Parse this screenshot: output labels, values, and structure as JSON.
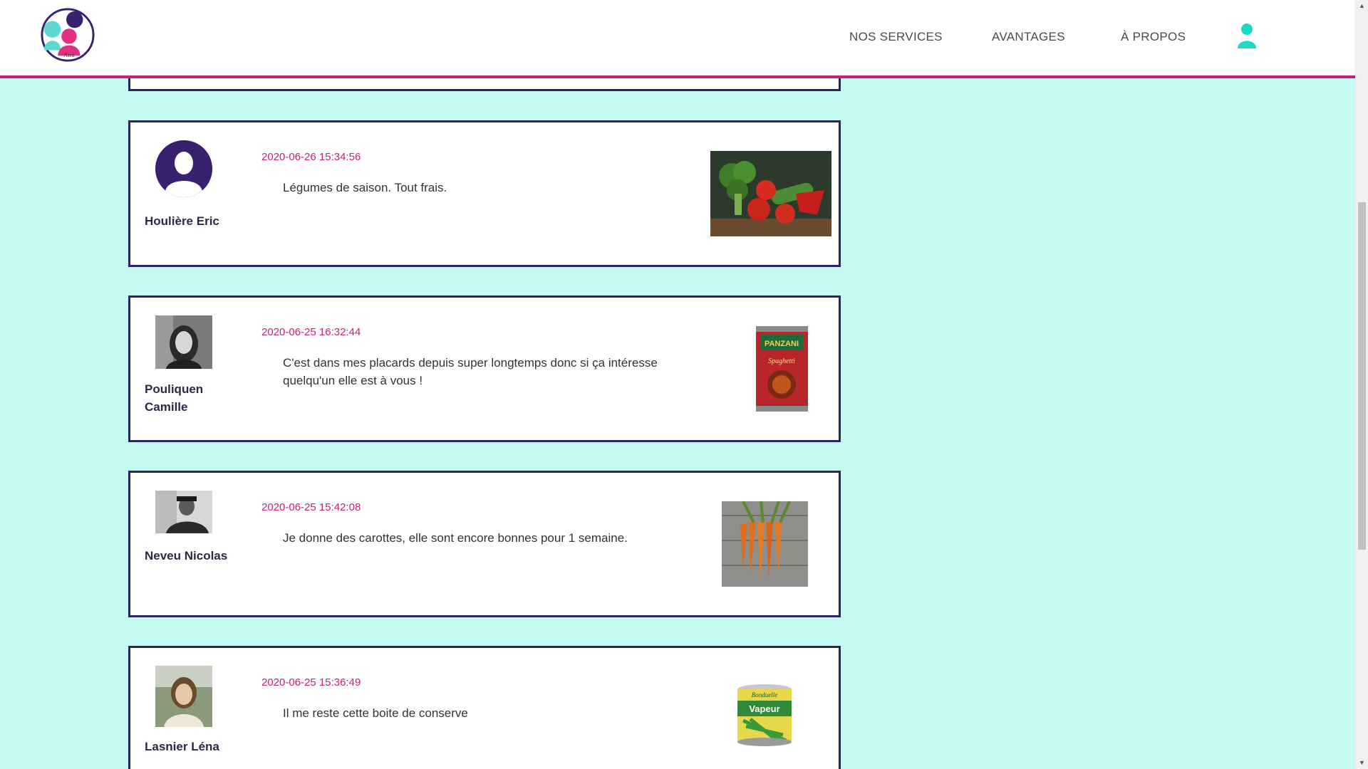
{
  "header": {
    "logo_icon": "ami-logo-icon",
    "nav": {
      "services": "NOS SERVICES",
      "avantages": "AVANTAGES",
      "apropos": "À PROPOS"
    },
    "user_icon": "user-icon"
  },
  "colors": {
    "background": "#c6fbf3",
    "accent": "#c2227a",
    "card_border": "#2a2560",
    "user_icon": "#1ed9c5"
  },
  "posts": [
    {
      "timestamp": "2020-06-26 15:34:56",
      "author": "Houlière Eric",
      "message": "Légumes de saison. Tout frais.",
      "avatar_icon": "default-avatar-icon",
      "product_icon": "vegetables-photo"
    },
    {
      "timestamp": "2020-06-25 16:32:44",
      "author": "Pouliquen Camille",
      "message": "C'est dans mes placards depuis super longtemps donc si ça intéresse quelqu'un elle est à vous !",
      "avatar_icon": "user-photo",
      "product_icon": "spaghetti-can-photo"
    },
    {
      "timestamp": "2020-06-25 15:42:08",
      "author": "Neveu Nicolas",
      "message": "Je donne des carottes, elle sont encore bonnes pour 1 semaine.",
      "avatar_icon": "user-photo",
      "product_icon": "carrots-photo"
    },
    {
      "timestamp": "2020-06-25 15:36:49",
      "author": "Lasnier Léna",
      "message": "Il me reste cette boite de conserve",
      "avatar_icon": "user-photo",
      "product_icon": "green-beans-can-photo"
    }
  ]
}
